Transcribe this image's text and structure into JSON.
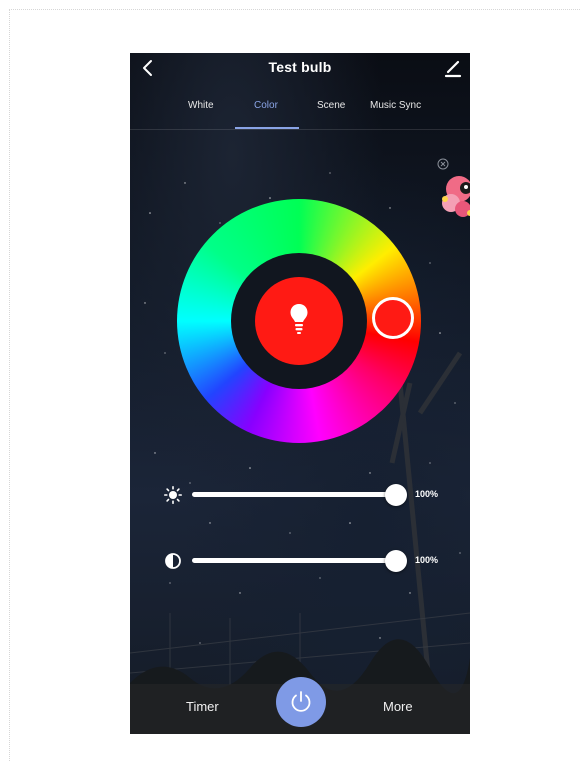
{
  "header": {
    "title": "Test bulb",
    "back_icon": "chevron-left-icon",
    "edit_icon": "pencil-icon"
  },
  "tabs": [
    {
      "label": "White",
      "active": false
    },
    {
      "label": "Color",
      "active": true
    },
    {
      "label": "Scene",
      "active": false
    },
    {
      "label": "Music Sync",
      "active": false
    }
  ],
  "color_picker": {
    "selected_color": "#ff1a14",
    "center_icon": "lightbulb-icon"
  },
  "sliders": {
    "brightness": {
      "icon": "sun-icon",
      "value": 100,
      "label": "100%"
    },
    "saturation": {
      "icon": "contrast-icon",
      "value": 100,
      "label": "100%"
    }
  },
  "bottom_bar": {
    "timer_label": "Timer",
    "more_label": "More",
    "power_icon": "power-icon",
    "power_color": "#7f9ae6"
  },
  "accent_color": "#8aa4e6"
}
